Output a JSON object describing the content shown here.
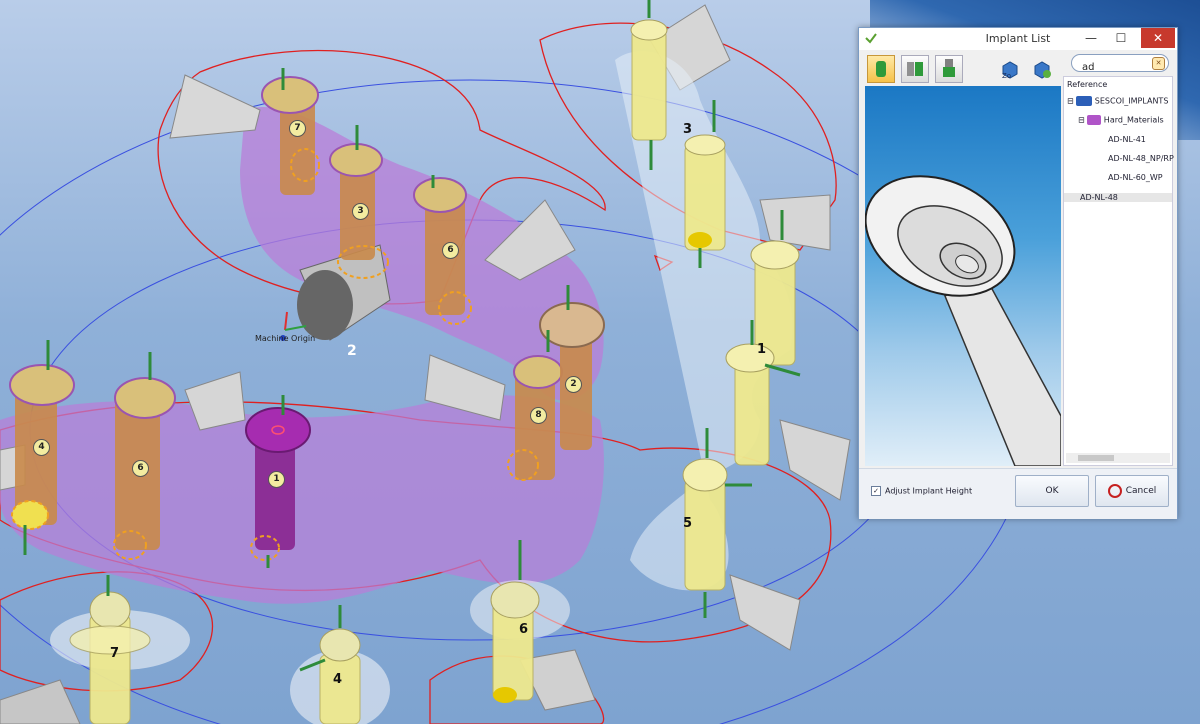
{
  "viewport": {
    "origin_label": "Machine Origin",
    "part_label": "2",
    "upper_numbers": [
      "7",
      "3",
      "6",
      "8",
      "2",
      "4",
      "6",
      "1"
    ],
    "right_numbers": [
      "3",
      "1",
      "5",
      "6",
      "7",
      "4"
    ]
  },
  "dialog": {
    "title": "Implant List",
    "window_controls": {
      "minimize": "—",
      "maximize": "☐",
      "close": "✕"
    },
    "search": {
      "value": "ad",
      "placeholder": ""
    },
    "toolbar": [
      {
        "name": "implant-body-view",
        "active": true
      },
      {
        "name": "implant-abutment-view",
        "active": false
      },
      {
        "name": "implant-screw-view",
        "active": false
      },
      {
        "name": "zoom-fit-button",
        "active": false
      },
      {
        "name": "rotate-view-button",
        "active": false
      }
    ],
    "tree": {
      "root_label": "Reference",
      "folder1": "SESCOI_IMPLANTS",
      "folder2": "Hard_Materials",
      "items": [
        "AD-NL-41",
        "AD-NL-48_NP/RP",
        "AD-NL-60_WP"
      ],
      "selected": "AD-NL-48"
    },
    "adjust_height_label": "Adjust Implant Height",
    "adjust_height_checked": true,
    "ok_label": "OK",
    "cancel_label": "Cancel"
  },
  "colors": {
    "background_top": "#b9cde9",
    "gum": "#b97ed8",
    "implant_orange": "#c98a4a",
    "implant_yellow": "#eee98e",
    "outline_red": "#e02020",
    "ok_accent": "#c62020"
  }
}
